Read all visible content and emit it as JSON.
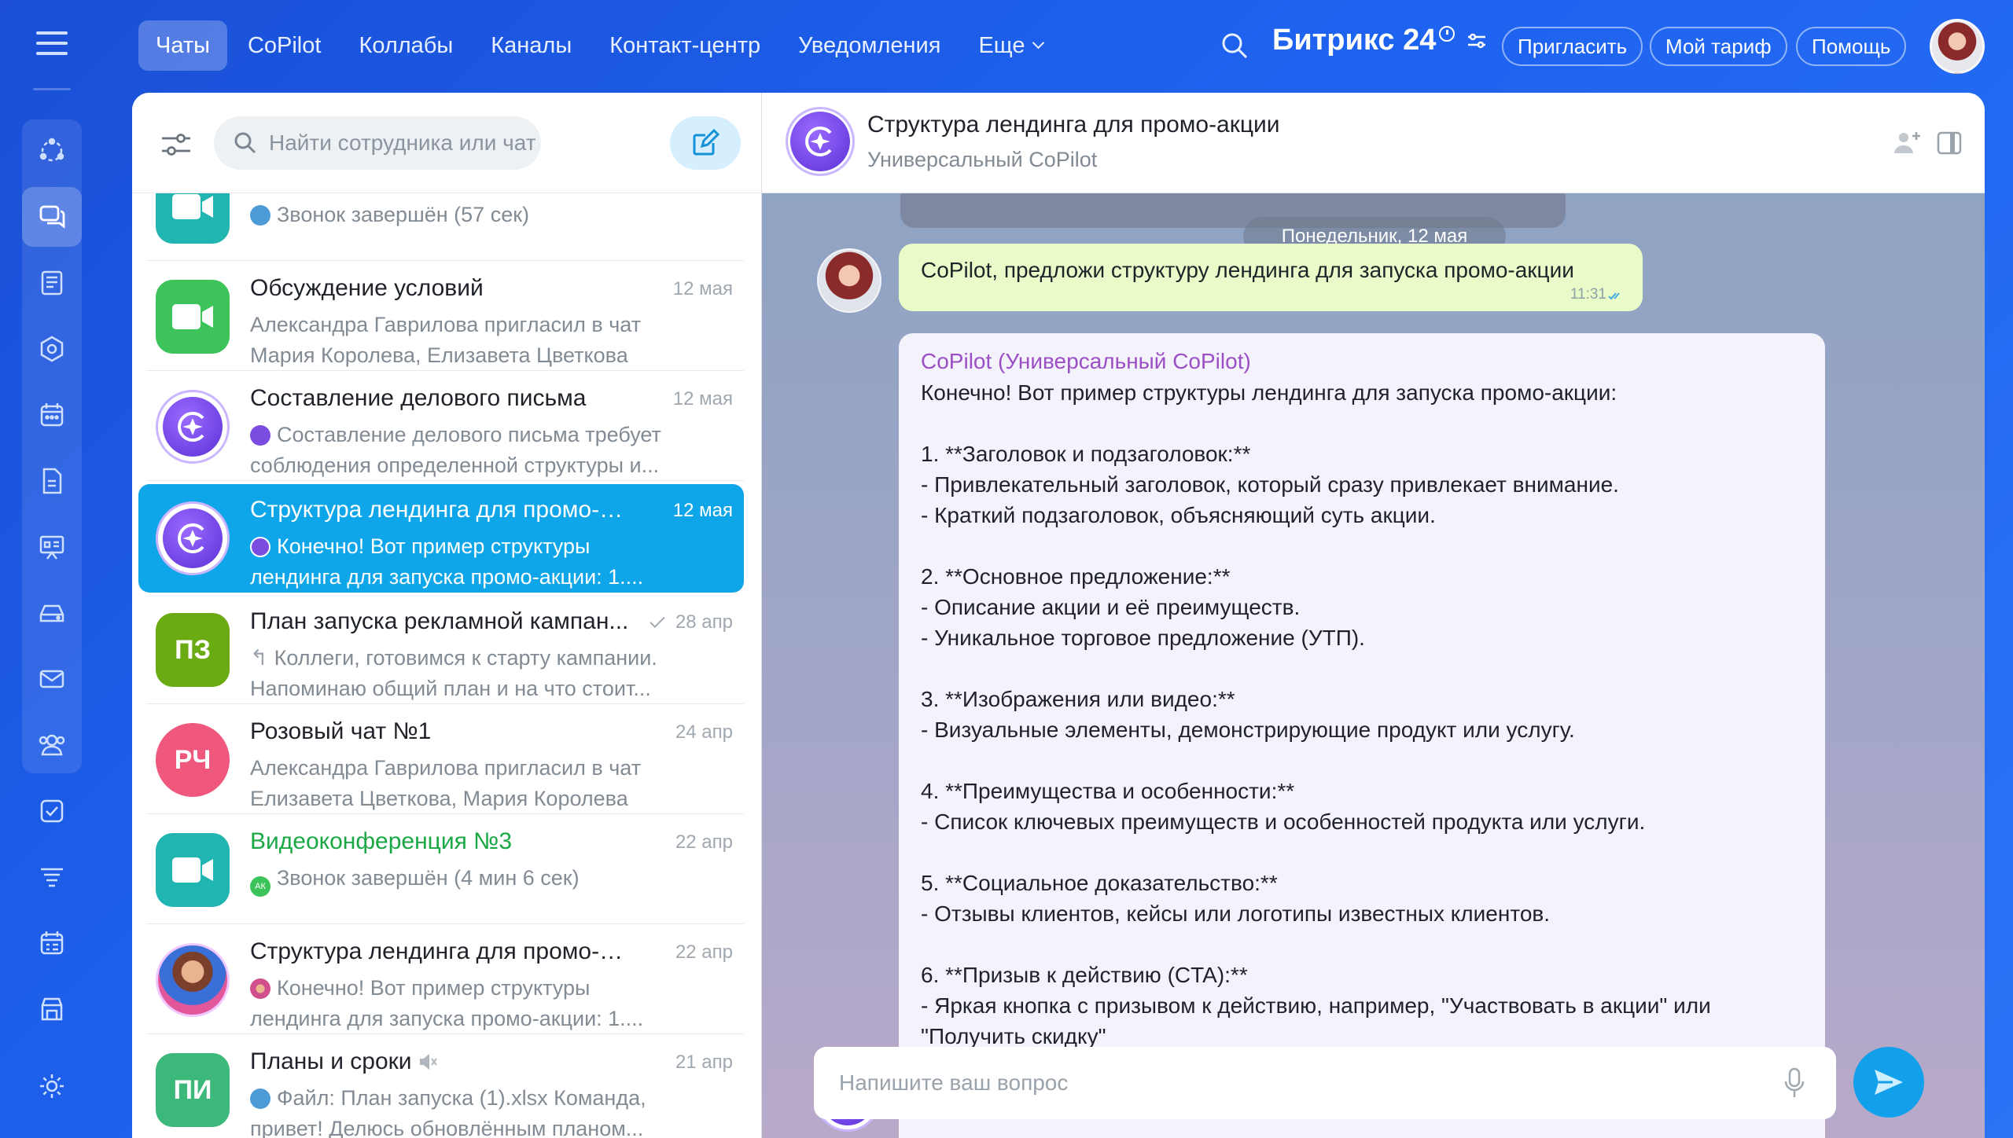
{
  "nav": {
    "items": [
      {
        "label": "Чаты",
        "active": true
      },
      {
        "label": "CoPilot",
        "active": false
      },
      {
        "label": "Коллабы",
        "active": false
      },
      {
        "label": "Каналы",
        "active": false
      },
      {
        "label": "Контакт-центр",
        "active": false
      },
      {
        "label": "Уведомления",
        "active": false
      },
      {
        "label": "Еще",
        "active": false
      }
    ]
  },
  "brand": {
    "name": "Битрикс 24"
  },
  "top_buttons": {
    "invite": "Пригласить",
    "tariff": "Мой тариф",
    "help": "Помощь"
  },
  "list": {
    "search_placeholder": "Найти сотрудника или чат",
    "rows": [
      {
        "title": "",
        "date": "",
        "sub": [
          "Звонок завершён (57 сек)"
        ]
      },
      {
        "title": "Обсуждение условий",
        "date": "12 мая",
        "sub": [
          "Александра Гаврилова пригласил в чат",
          "Мария Королева, Елизавета Цветкова"
        ]
      },
      {
        "title": "Составление делового письма",
        "date": "12 мая",
        "sub": [
          "Составление делового письма требует",
          "соблюдения определенной структуры и..."
        ]
      },
      {
        "title": "Структура лендинга для промо-ак...",
        "date": "12 мая",
        "sub": [
          "Конечно! Вот пример структуры",
          "лендинга для запуска промо-акции: 1...."
        ]
      },
      {
        "title": "План запуска рекламной кампан...",
        "date": "28 апр",
        "sub": [
          "Коллеги, готовимся к старту кампании.",
          "Напоминаю общий план и на что стоит..."
        ],
        "initials": "ПЗ"
      },
      {
        "title": "Розовый чат №1",
        "date": "24 апр",
        "sub": [
          "Александра Гаврилова пригласил в чат",
          "Елизавета Цветкова, Мария Королева"
        ],
        "initials": "РЧ"
      },
      {
        "title": "Видеоконференция №3",
        "date": "22 апр",
        "sub": [
          "Звонок завершён (4 мин 6 сек)"
        ],
        "mini_initials": "АК"
      },
      {
        "title": "Структура лендинга для промо-ак...",
        "date": "22 апр",
        "sub": [
          "Конечно! Вот пример структуры",
          "лендинга для запуска промо-акции: 1...."
        ]
      },
      {
        "title": "Планы и сроки",
        "date": "21 апр",
        "sub": [
          "Файл: План запуска (1).xlsx Команда,",
          "привет! Делюсь обновлённым планом..."
        ],
        "initials": "ПИ"
      }
    ]
  },
  "chat": {
    "title": "Структура лендинга для промо-акции",
    "subtitle": "Универсальный CoPilot",
    "date_divider": "Понедельник, 12 мая",
    "user_message": {
      "text": "CoPilot, предложи структуру лендинга для запуска промо-акции",
      "time": "11:31"
    },
    "bot_message": {
      "author": "CoPilot (Универсальный CoPilot)",
      "lines": [
        "Конечно! Вот пример структуры лендинга для запуска промо-акции:",
        "",
        "1. **Заголовок и подзаголовок:**",
        "- Привлекательный заголовок, который сразу привлекает внимание.",
        "- Краткий подзаголовок, объясняющий суть акции.",
        "",
        "2. **Основное предложение:**",
        "- Описание акции и её преимуществ.",
        "- Уникальное торговое предложение (УТП).",
        "",
        "3. **Изображения или видео:**",
        "- Визуальные элементы, демонстрирующие продукт или услугу.",
        "",
        "4. **Преимущества и особенности:**",
        "- Список ключевых преимуществ и особенностей продукта или услуги.",
        "",
        "5. **Социальное доказательство:**",
        "- Отзывы клиентов, кейсы или логотипы известных клиентов.",
        "",
        "6. **Призыв к действию (CTA):**",
        "- Яркая кнопка с призывом к действию, например, \"Участвовать в акции\" или",
        "\"Получить скидку\""
      ]
    },
    "input_placeholder": "Напишите ваш вопрос"
  },
  "colors": {
    "accent": "#0ea5e9",
    "brand_bg": "#1e63f0",
    "copilot": "#6b3ce0",
    "green_title": "#1aa845"
  }
}
